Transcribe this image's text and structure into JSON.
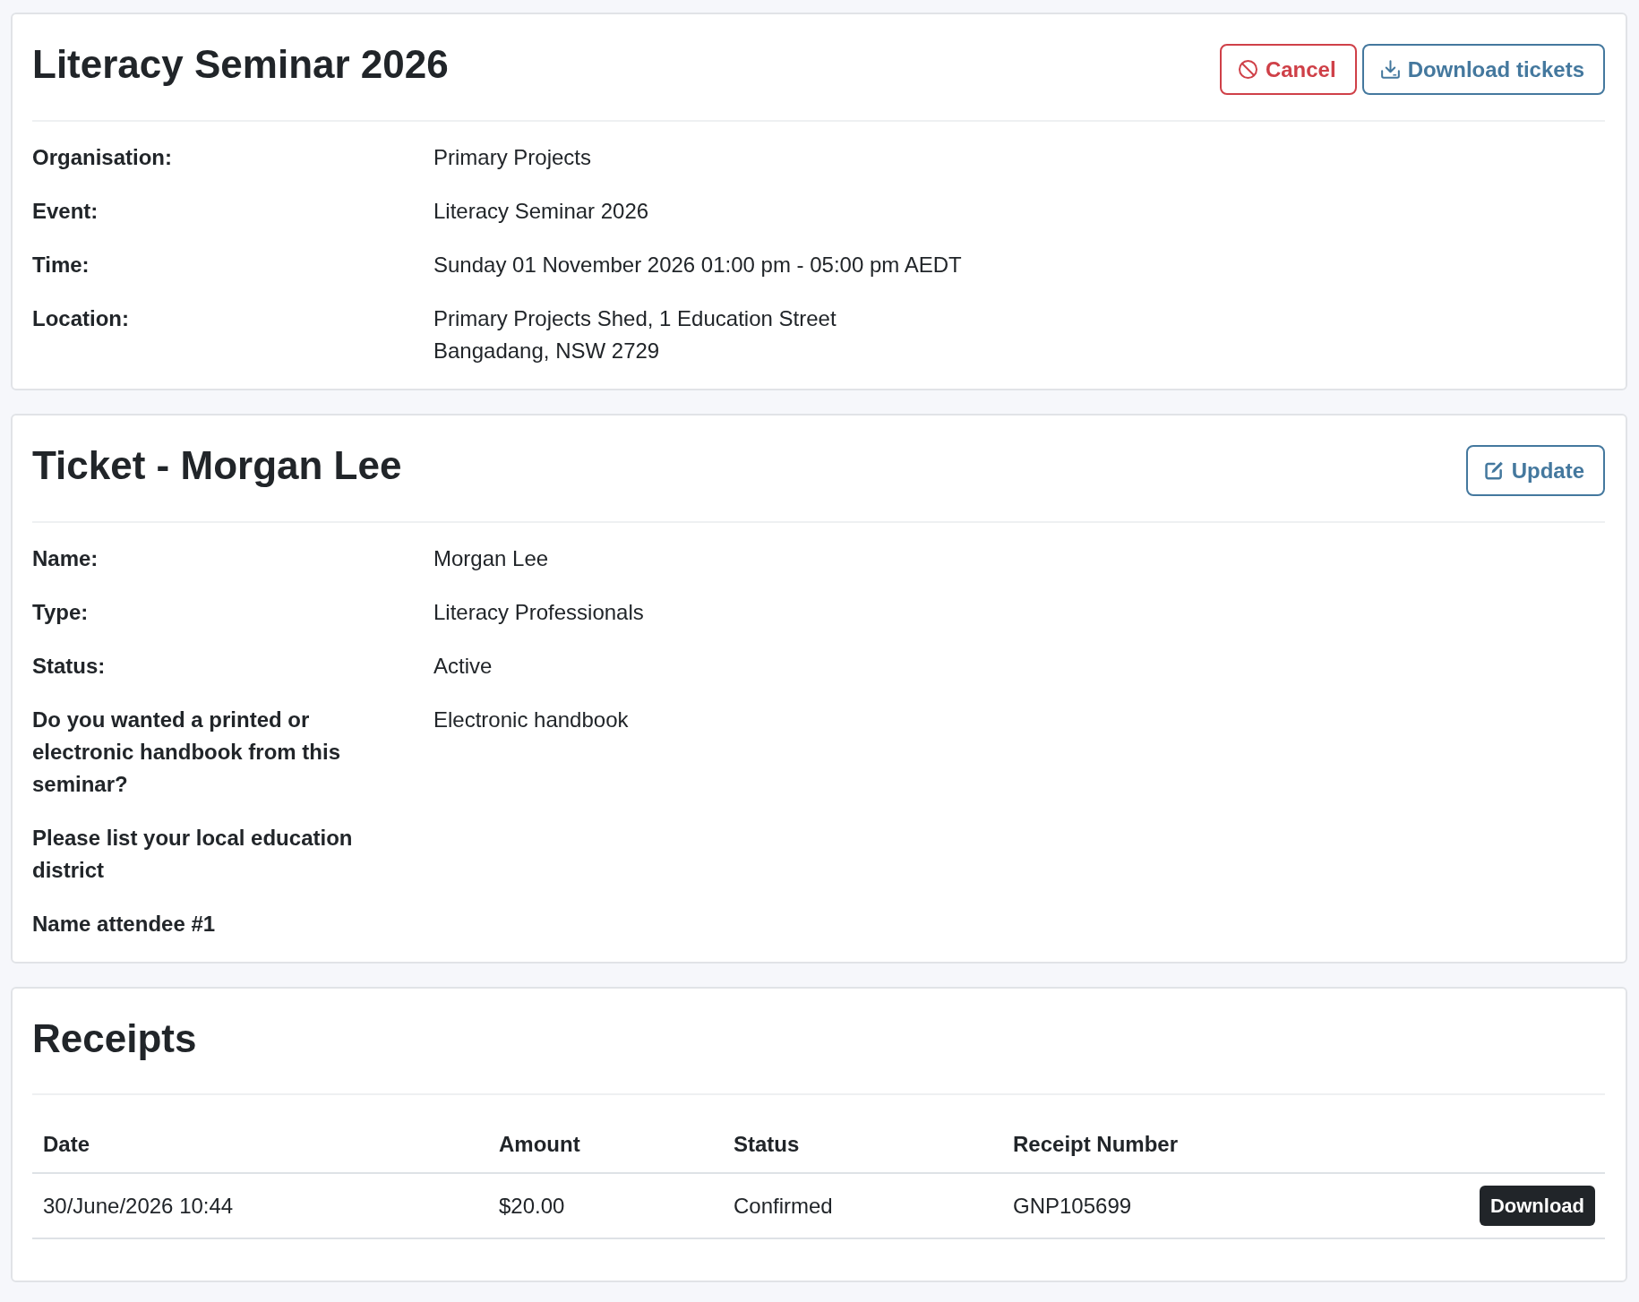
{
  "event": {
    "title": "Literacy Seminar 2026",
    "actions": [
      {
        "kind": "cancel",
        "label": "Cancel"
      },
      {
        "kind": "download",
        "label": "Download tickets"
      }
    ],
    "details": [
      {
        "label": "Organisation:",
        "lines": [
          "Primary Projects"
        ]
      },
      {
        "label": "Event:",
        "lines": [
          "Literacy Seminar 2026"
        ]
      },
      {
        "label": "Time:",
        "lines": [
          "Sunday 01 November 2026 01:00 pm - 05:00 pm AEDT"
        ]
      },
      {
        "label": "Location:",
        "lines": [
          "Primary Projects Shed, 1 Education Street",
          "Bangadang, NSW 2729"
        ]
      }
    ]
  },
  "ticket": {
    "title": "Ticket - Morgan Lee",
    "actions": [
      {
        "kind": "edit",
        "label": "Update"
      }
    ],
    "details": [
      {
        "label": "Name:",
        "lines": [
          "Morgan Lee"
        ]
      },
      {
        "label": "Type:",
        "lines": [
          "Literacy Professionals"
        ]
      },
      {
        "label": "Status:",
        "lines": [
          "Active"
        ]
      },
      {
        "label": "Do you wanted a printed or electronic handbook from this seminar?",
        "lines": [
          "Electronic handbook"
        ]
      },
      {
        "label": "Please list your local education district"
      },
      {
        "label": "Name attendee #1"
      }
    ]
  },
  "receipts": {
    "title": "Receipts",
    "table": {
      "columns": [
        "Date",
        "Amount",
        "Status",
        "Receipt Number"
      ],
      "rows": [
        {
          "cells": [
            "30/June/2026 10:44",
            "$20.00",
            "Confirmed",
            "GNP105699"
          ],
          "action": "Download"
        }
      ]
    }
  }
}
